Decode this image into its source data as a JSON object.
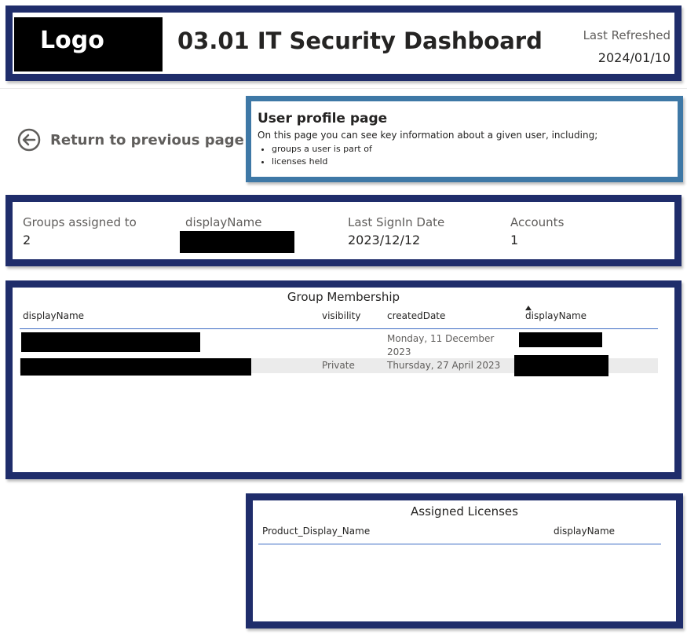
{
  "header": {
    "logo_text": "Logo",
    "title": "03.01 IT Security Dashboard",
    "last_refreshed_label": "Last Refreshed",
    "last_refreshed_value": "2024/01/10"
  },
  "navigation": {
    "return_label": "Return to previous page",
    "return_icon": "arrow-left-circle-icon"
  },
  "info": {
    "title": "User profile page",
    "description": "On this page you can see key information about a given user, including;",
    "bullets": [
      "groups a user is part of",
      "licenses held"
    ]
  },
  "kpis": [
    {
      "label": "Groups assigned to",
      "value": "2"
    },
    {
      "label": "displayName",
      "value": ""
    },
    {
      "label": "Last SignIn Date",
      "value": "2023/12/12"
    },
    {
      "label": "Accounts",
      "value": "1"
    }
  ],
  "group_membership": {
    "title": "Group Membership",
    "columns": [
      "displayName",
      "visibility",
      "createdDate",
      "displayName"
    ],
    "rows": [
      {
        "displayName": "",
        "visibility": "",
        "createdDate_line1": "Monday, 11 December",
        "createdDate_line2": "2023",
        "owner": ""
      },
      {
        "displayName": "",
        "visibility": "Private",
        "createdDate_line1": "Thursday, 27 April 2023",
        "createdDate_line2": "",
        "owner": ""
      }
    ]
  },
  "assigned_licenses": {
    "title": "Assigned Licenses",
    "columns": [
      "Product_Display_Name",
      "displayName"
    ]
  },
  "colors": {
    "panel_border": "#1f2d6b",
    "info_border": "#3e78a6",
    "header_underline": "#3c6cc4",
    "alt_row": "#ebebeb"
  }
}
